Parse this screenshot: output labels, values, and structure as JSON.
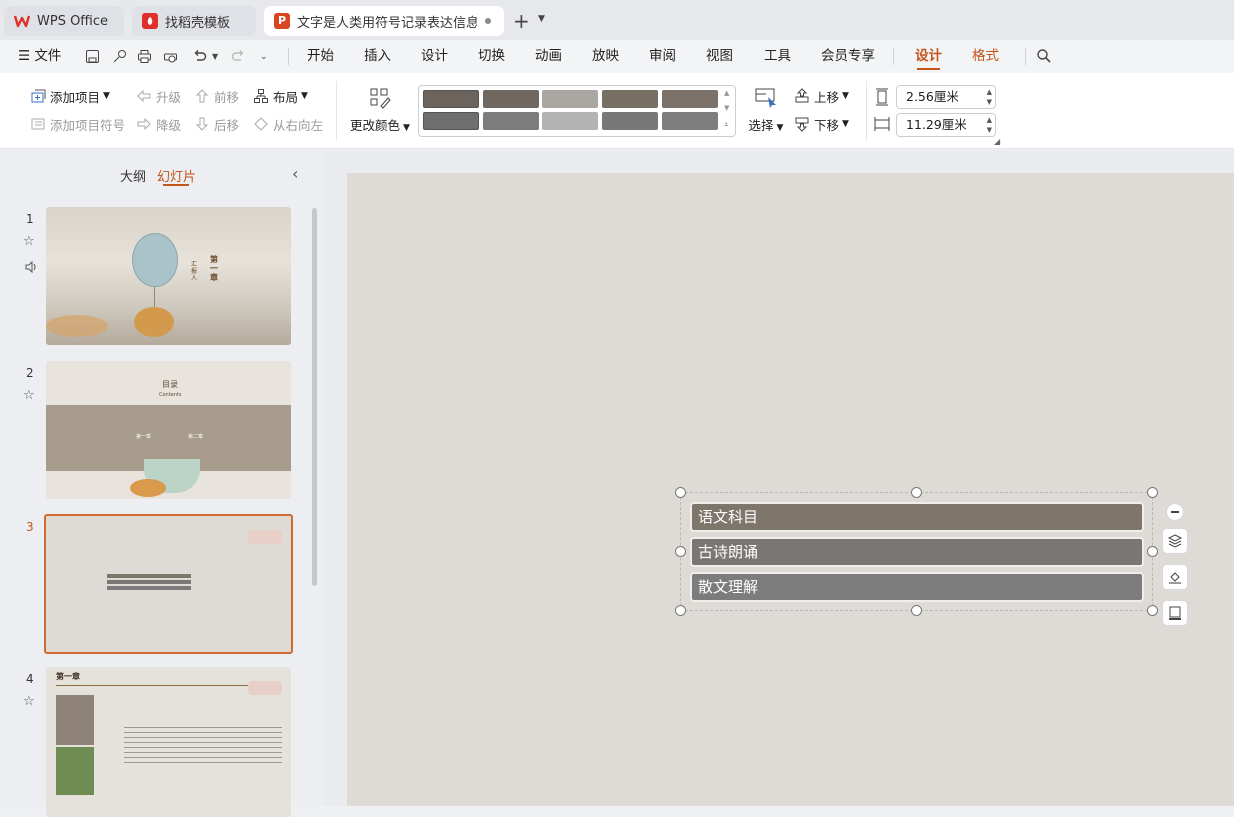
{
  "tabs": [
    {
      "label": "WPS Office"
    },
    {
      "label": "找稻壳模板"
    },
    {
      "label": "文字是人类用符号记录表达信息以"
    }
  ],
  "menu": {
    "file": "文件",
    "items": [
      "开始",
      "插入",
      "设计",
      "切换",
      "动画",
      "放映",
      "审阅",
      "视图",
      "工具",
      "会员专享",
      "设计",
      "格式"
    ]
  },
  "ribbon": {
    "add_item": "添加项目",
    "add_bullet": "添加项目符号",
    "promote": "升级",
    "demote": "降级",
    "move_forward": "前移",
    "move_back": "后移",
    "layout": "布局",
    "rtl": "从右向左",
    "change_color": "更改颜色",
    "select": "选择",
    "move_up": "上移",
    "move_down": "下移",
    "height_value": "2.56厘米",
    "width_value": "11.29厘米"
  },
  "panel": {
    "outline_tab": "大纲",
    "slides_tab": "幻灯片"
  },
  "slides": [
    {
      "number": "1",
      "chapter": "第一章",
      "presenter": "汇报人"
    },
    {
      "number": "2",
      "title": "目录",
      "subtitle": "Contents",
      "item1": "第一章",
      "item2": "第二章"
    },
    {
      "number": "3"
    },
    {
      "number": "4",
      "title": "第一章"
    }
  ],
  "smartart": {
    "items": [
      "语文科目",
      "古诗朗诵",
      "散文理解"
    ]
  },
  "colors": {
    "accent": "#c4541a",
    "bar1": "#7e756b",
    "bar2": "#7b7774",
    "bar3": "#7c7c7c"
  }
}
